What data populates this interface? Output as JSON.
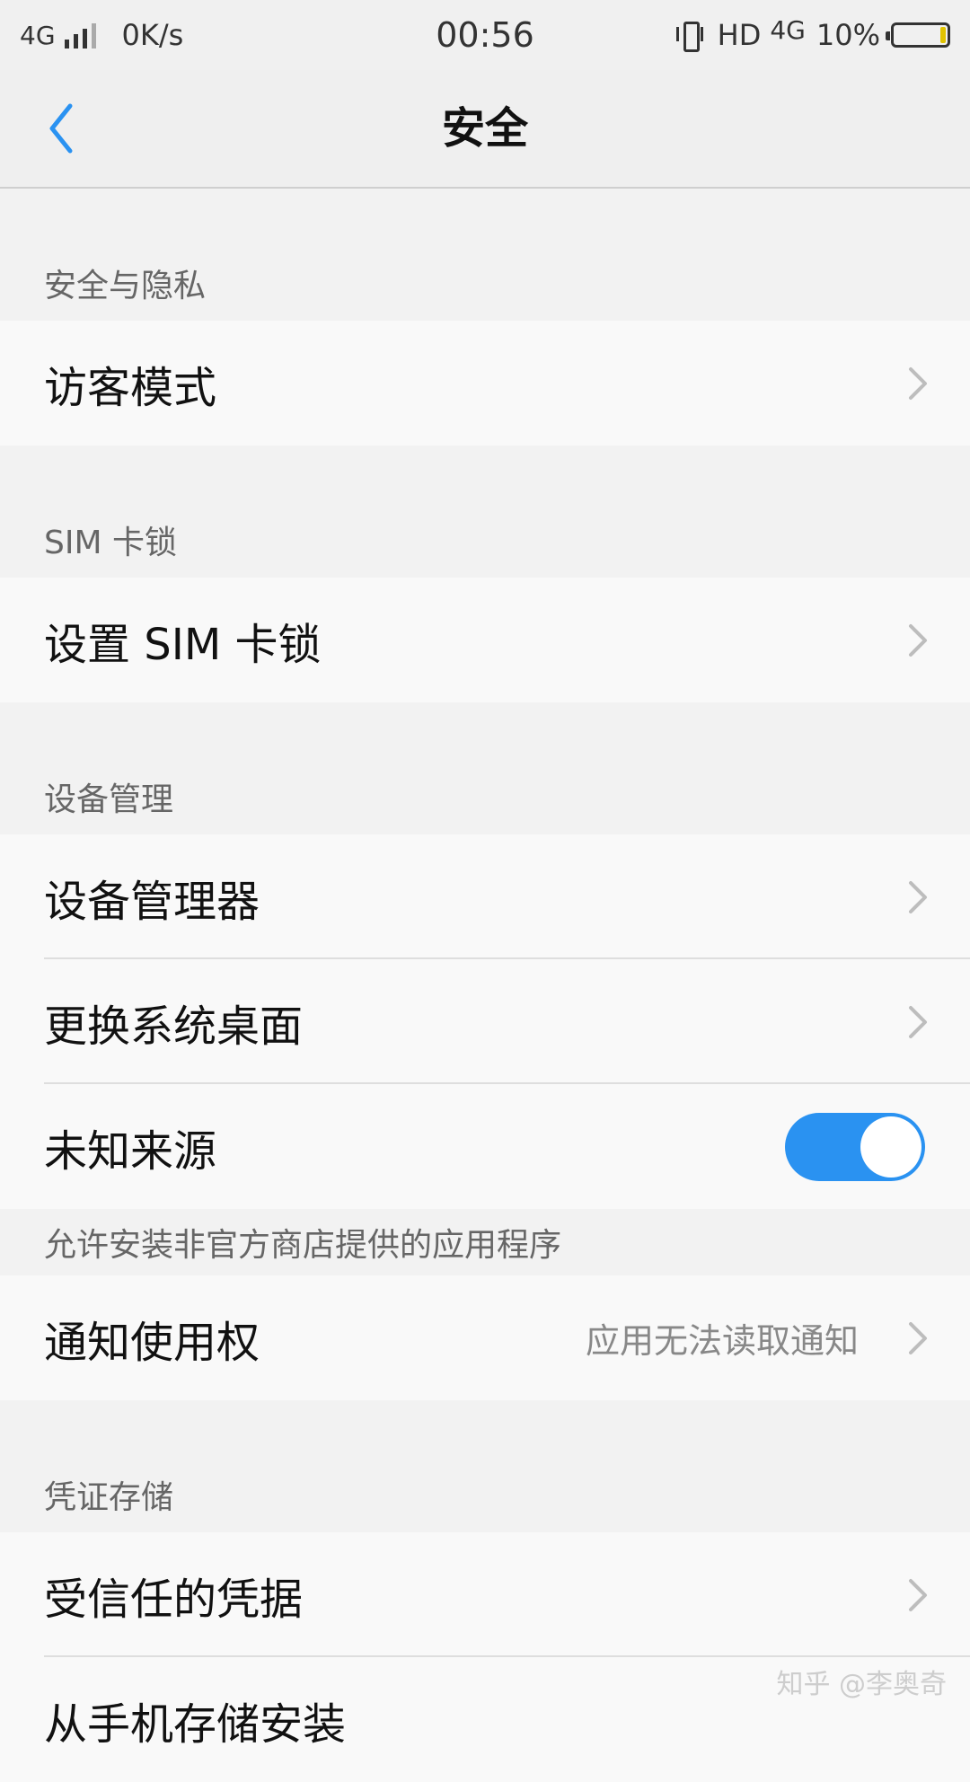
{
  "status_bar": {
    "network": "4G",
    "speed": "0K/s",
    "time": "00:56",
    "hd": "HD",
    "network2": "4G",
    "battery": "10%"
  },
  "nav": {
    "back_icon": "chevron-left-icon",
    "title": "安全"
  },
  "sections": {
    "privacy": {
      "header": "安全与隐私",
      "visitor_mode": "访客模式"
    },
    "sim": {
      "header": "SIM 卡锁",
      "set_sim_lock": "设置 SIM 卡锁"
    },
    "device": {
      "header": "设备管理",
      "device_admin": "设备管理器",
      "change_launcher": "更换系统桌面",
      "unknown_sources": "未知来源",
      "unknown_sources_enabled": true,
      "unknown_sources_hint": "允许安装非官方商店提供的应用程序",
      "notification_access": "通知使用权",
      "notification_access_value": "应用无法读取通知"
    },
    "credentials": {
      "header": "凭证存储",
      "trusted_credentials": "受信任的凭据",
      "install_from_storage": "从手机存储安装"
    }
  },
  "watermark": "知乎 @李奥奇",
  "colors": {
    "accent": "#2a92f1",
    "background": "#f2f2f2",
    "row_background": "#f9f9f9"
  }
}
